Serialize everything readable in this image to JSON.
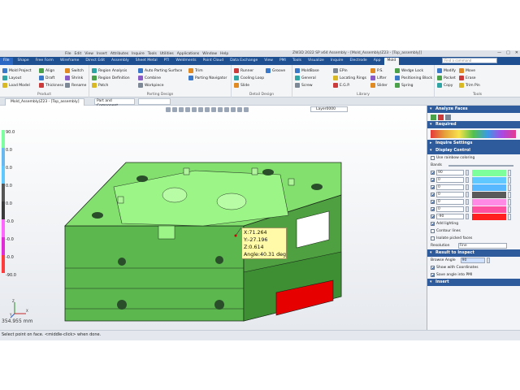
{
  "titlebar": {
    "menu": [
      "File",
      "Edit",
      "View",
      "Insert",
      "Attributes",
      "Inquire",
      "Tools",
      "Utilities",
      "Applications",
      "Window",
      "Help"
    ],
    "title": "ZW3D 2022 SP x64       Assembly - [Mold_Assembly(Z23 - [Top_assembly]]",
    "min": "—",
    "max": "□",
    "close": "✕"
  },
  "tabs": [
    "File",
    "Shape",
    "Free Form",
    "Wireframe",
    "Direct Edit",
    "Assembly",
    "Sheet Metal",
    "PTI",
    "Weldments",
    "Point Cloud",
    "Data Exchange",
    "View",
    "PMI",
    "Tools",
    "Visualize",
    "Inquire",
    "Electrode",
    "App",
    "Mold"
  ],
  "search_placeholder": "Find a command",
  "ribbon": {
    "product": {
      "caption": "Product",
      "items": [
        "Mold Project",
        "Align",
        "Switch",
        "Layout",
        "Draft",
        "Shrink",
        "Load Model",
        "Thickness",
        "Rename"
      ]
    },
    "parting": {
      "caption": "Parting Design",
      "items": [
        "Region Analysis",
        "Auto Parting Surface",
        "Trim",
        "Region Definition",
        "Combine",
        "Parting Navigator",
        "Patch",
        "Workpiece"
      ]
    },
    "detail": {
      "caption": "Detail Design",
      "items": [
        "Runner",
        "Groove",
        "Cooling Loop",
        "Slide"
      ]
    },
    "library": {
      "caption": "Library",
      "items": [
        "MoldBase",
        "EPin",
        "P.S.",
        "Wedge Lock",
        "General",
        "Locating Rings",
        "Lifter",
        "Positioning Block",
        "Screw",
        "E.G.P.",
        "Slider",
        "Spring"
      ]
    },
    "tools": {
      "caption": "Tools",
      "items": [
        "Modify",
        "Move",
        "Pocket",
        "Erase",
        "Copy",
        "Trim Pin"
      ]
    }
  },
  "doc_tab": "Mold_Assembly(Z23 - [Top_assembly]",
  "filter": "Part and Component",
  "layer": "Layer0000",
  "legend": {
    "labels": [
      "90.0",
      "0.0",
      "0.0",
      "0.0",
      "0.0",
      "-0.0",
      "-0.0",
      "-0.0",
      "-90.0"
    ],
    "colors": [
      "#7dffa1",
      "#6ab8f0",
      "#5ec8ff",
      "#555555",
      "#3a3a3a",
      "#ff67ff",
      "#e12bd6",
      "#ff3b3b",
      "#e60000"
    ]
  },
  "scale": "354.955 mm",
  "triad": {
    "x": "X",
    "y": "Y",
    "z": "Z"
  },
  "probe": [
    "X:71.264",
    "Y:-27.196",
    "Z:0.614",
    "Angle:40.31 deg"
  ],
  "panel": {
    "title": "Analyze Faces",
    "required": "Required",
    "inquire_settings": "Inquire Settings",
    "display_control": "Display Control",
    "rainbow": "Use rainbow coloring",
    "bands": "Bands",
    "bands_rows": [
      {
        "value": "90",
        "color": "#7dff9b"
      },
      {
        "value": "0",
        "color": "#5ec8ff"
      },
      {
        "value": "0",
        "color": "#58b8ff"
      },
      {
        "value": "0",
        "color": "#5a5a5a"
      },
      {
        "value": "0",
        "color": "#ff8ae6"
      },
      {
        "value": "0",
        "color": "#ff4fa0"
      },
      {
        "value": "-90",
        "color": "#ff1f1f"
      }
    ],
    "add_lighting": "Add lighting",
    "contour_lines": "Contour lines",
    "isolate": "Isolate picked faces",
    "resolution_label": "Resolution",
    "resolution_value": "Fine",
    "result_to_inspect": "Result to Inspect",
    "browse_label": "Browse Angle",
    "browse_value": "90",
    "show_coords": "Show with Coordinates",
    "save_angle": "Save angle into PMI",
    "insert": "Insert"
  },
  "status": "Select point on face. <middle-click> when done."
}
